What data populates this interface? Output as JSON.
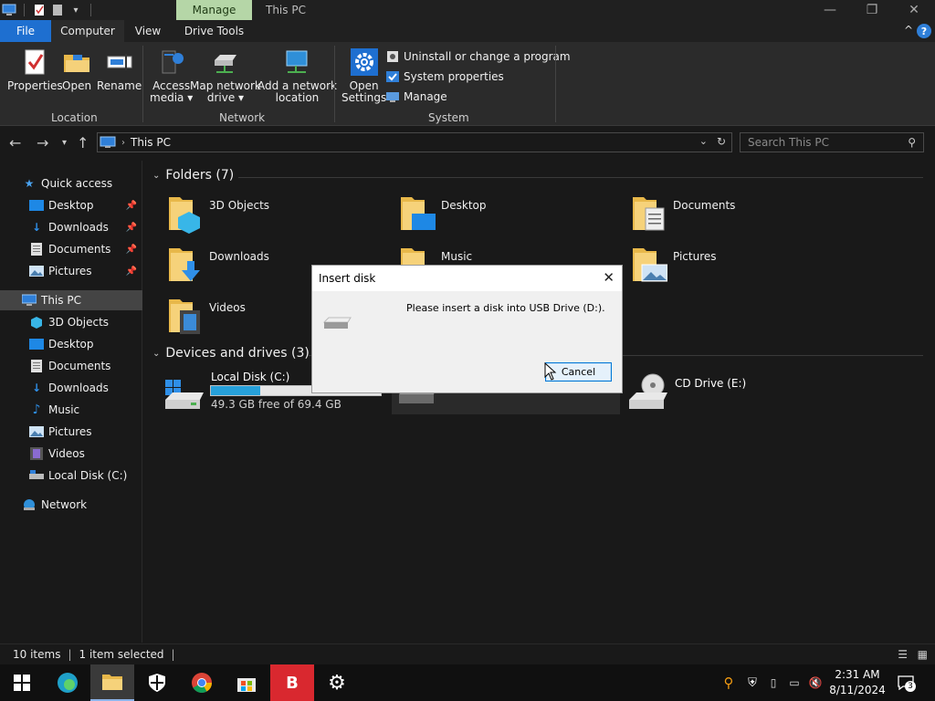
{
  "window": {
    "title": "This PC",
    "context_tab": "Manage",
    "minimize": "—",
    "maximize": "❐",
    "close": "✕"
  },
  "ribbon": {
    "tabs": [
      "File",
      "Computer",
      "View",
      "Drive Tools"
    ],
    "collapse": "^",
    "help": "?",
    "location": {
      "label": "Location",
      "properties": "Properties",
      "open": "Open",
      "rename": "Rename"
    },
    "network": {
      "label": "Network",
      "access_media_1": "Access",
      "access_media_2": "media ▾",
      "map_drive_1": "Map network",
      "map_drive_2": "drive ▾",
      "add_location_1": "Add a network",
      "add_location_2": "location"
    },
    "system": {
      "label": "System",
      "open_settings_1": "Open",
      "open_settings_2": "Settings",
      "uninstall": "Uninstall or change a program",
      "system_properties": "System properties",
      "manage": "Manage"
    }
  },
  "address": {
    "path": "This PC",
    "search_placeholder": "Search This PC"
  },
  "sidebar": {
    "quick_access": "Quick access",
    "quick_items": [
      "Desktop",
      "Downloads",
      "Documents",
      "Pictures"
    ],
    "this_pc": "This PC",
    "pc_items": [
      "3D Objects",
      "Desktop",
      "Documents",
      "Downloads",
      "Music",
      "Pictures",
      "Videos",
      "Local Disk (C:)"
    ],
    "network": "Network"
  },
  "content": {
    "folders_header": "Folders (7)",
    "folders": [
      "3D Objects",
      "Desktop",
      "Documents",
      "Downloads",
      "Music",
      "Pictures",
      "Videos"
    ],
    "devices_header": "Devices and drives (3)",
    "drive_c": {
      "name": "Local Disk (C:)",
      "free": "49.3 GB free of 69.4 GB",
      "used_fraction": 0.29
    },
    "drive_e": {
      "name": "CD Drive (E:)"
    }
  },
  "dialog": {
    "title": "Insert disk",
    "message": "Please insert a disk into USB Drive (D:).",
    "cancel": "Cancel",
    "close": "✕"
  },
  "status": {
    "items": "10 items",
    "selected": "1 item selected"
  },
  "taskbar": {
    "time": "2:31 AM",
    "date": "8/11/2024",
    "notifications": "3"
  },
  "colors": {
    "accent": "#1e6fd0",
    "drive_bar": "#26a0da",
    "manage_tab": "#b5d6a7"
  }
}
